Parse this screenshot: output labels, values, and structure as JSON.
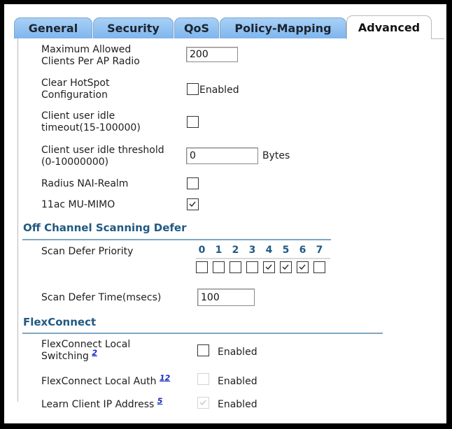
{
  "tabs": [
    {
      "label": "General",
      "active": false
    },
    {
      "label": "Security",
      "active": false
    },
    {
      "label": "QoS",
      "active": false
    },
    {
      "label": "Policy-Mapping",
      "active": false
    },
    {
      "label": "Advanced",
      "active": true
    }
  ],
  "fields": {
    "max_clients": {
      "label_line1": "Maximum Allowed",
      "label_line2": "Clients Per AP Radio",
      "value": "200"
    },
    "clear_hotspot": {
      "label_line1": "Clear HotSpot",
      "label_line2": "Configuration",
      "checked": false,
      "suffix": "Enabled"
    },
    "idle_timeout": {
      "label_line1": "Client user idle",
      "label_line2": "timeout(15-100000)",
      "checked": false
    },
    "idle_threshold": {
      "label_line1": "Client user idle threshold",
      "label_line2": "(0-10000000)",
      "value": "0",
      "unit": "Bytes"
    },
    "radius_nai": {
      "label": "Radius NAI-Realm",
      "checked": false
    },
    "mu_mimo": {
      "label": "11ac MU-MIMO",
      "checked": true
    }
  },
  "off_channel": {
    "title": "Off Channel Scanning Defer",
    "priority_label": "Scan Defer Priority",
    "priorities": [
      {
        "num": "0",
        "checked": false
      },
      {
        "num": "1",
        "checked": false
      },
      {
        "num": "2",
        "checked": false
      },
      {
        "num": "3",
        "checked": false
      },
      {
        "num": "4",
        "checked": true
      },
      {
        "num": "5",
        "checked": true
      },
      {
        "num": "6",
        "checked": true
      },
      {
        "num": "7",
        "checked": false
      }
    ],
    "time_label": "Scan Defer Time(msecs)",
    "time_value": "100"
  },
  "flexconnect": {
    "title": "FlexConnect",
    "local_switching": {
      "label_line1": "FlexConnect Local",
      "label_line2": "Switching",
      "footnote": "2",
      "checked": false,
      "disabled": false,
      "suffix": "Enabled"
    },
    "local_auth": {
      "label": "FlexConnect Local Auth",
      "footnote": "12",
      "checked": false,
      "disabled": true,
      "suffix": "Enabled"
    },
    "learn_ip": {
      "label": "Learn Client IP Address",
      "footnote": "5",
      "checked": true,
      "disabled": true,
      "suffix": "Enabled"
    }
  }
}
